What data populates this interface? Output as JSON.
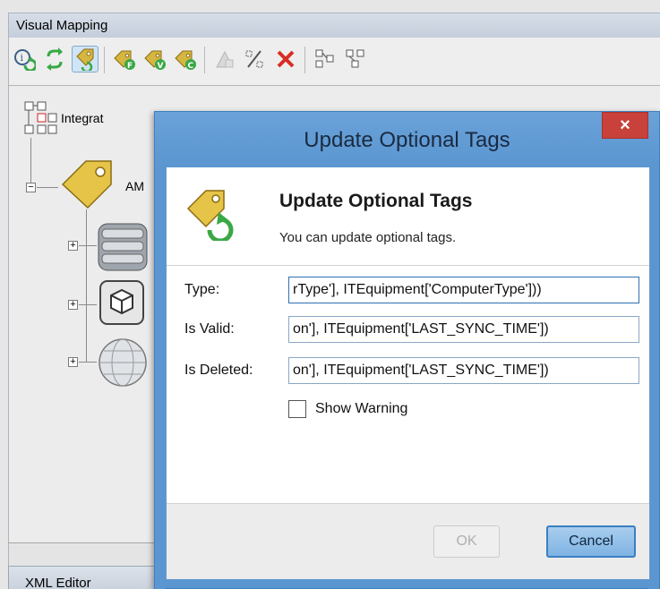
{
  "app": {
    "panel_title": "Visual Mapping",
    "bottom_tab": "XML Editor",
    "tree": {
      "root_label": "Integrat",
      "child_label": "AM"
    }
  },
  "toolbar": {
    "icons": [
      "info-refresh-icon",
      "green-arrow-refresh-icon",
      "tag-refresh-icon",
      "tag-f-add-icon",
      "tag-v-add-icon",
      "tag-c-add-icon",
      "triangle-disabled-icon",
      "percent-edit-icon",
      "delete-x-icon",
      "expand-nodes-icon",
      "collapse-nodes-icon"
    ]
  },
  "dialog": {
    "title": "Update Optional Tags",
    "close_label": "×",
    "header_title": "Update Optional Tags",
    "header_subtitle": "You can update optional tags.",
    "fields": {
      "type": {
        "label": "Type:",
        "value": "rType'], ITEquipment['ComputerType']))"
      },
      "is_valid": {
        "label": "Is Valid:",
        "value": "on'], ITEquipment['LAST_SYNC_TIME'])"
      },
      "is_deleted": {
        "label": "Is Deleted:",
        "value": "on'], ITEquipment['LAST_SYNC_TIME'])"
      }
    },
    "show_warning_label": "Show Warning",
    "ok_label": "OK",
    "cancel_label": "Cancel"
  },
  "colors": {
    "dialog_frame": "#5b96d1",
    "close_button": "#c9413b",
    "cancel_button": "#8fbfe8"
  }
}
